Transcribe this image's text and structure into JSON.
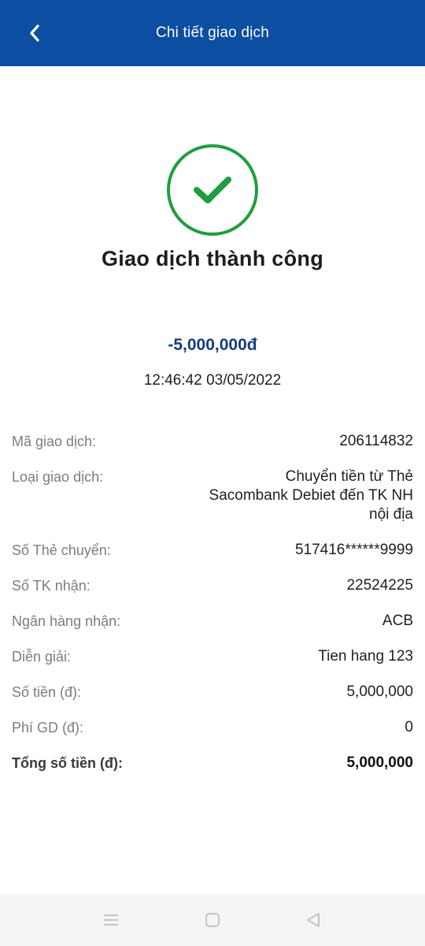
{
  "header": {
    "title": "Chi tiết giao dịch",
    "back_icon": "chevron-left-icon"
  },
  "result": {
    "icon": "check-circle-icon",
    "status_text": "Giao dịch thành công",
    "amount": "-5,000,000đ",
    "datetime": "12:46:42 03/05/2022"
  },
  "details": [
    {
      "label": "Mã giao dịch:",
      "value": "206114832"
    },
    {
      "label": "Loại giao dịch:",
      "value": "Chuyển tiền từ Thẻ Sacombank Debiet đến TK NH nội địa"
    },
    {
      "label": "Số Thẻ chuyển:",
      "value": "517416******9999"
    },
    {
      "label": "Số TK nhận:",
      "value": "22524225"
    },
    {
      "label": "Ngân hàng nhận:",
      "value": "ACB"
    },
    {
      "label": "Diễn giải:",
      "value": "Tien hang 123"
    },
    {
      "label": "Số tiền (đ):",
      "value": "5,000,000"
    },
    {
      "label": "Phí GD (đ):",
      "value": "0"
    },
    {
      "label": "Tổng số tiền (đ):",
      "value": "5,000,000"
    }
  ],
  "navbar": {
    "icons": [
      "menu-icon",
      "home-square-icon",
      "back-triangle-icon"
    ]
  },
  "colors": {
    "header": "#0b4ea2",
    "success": "#1e9e3e",
    "amount": "#123f7d"
  }
}
